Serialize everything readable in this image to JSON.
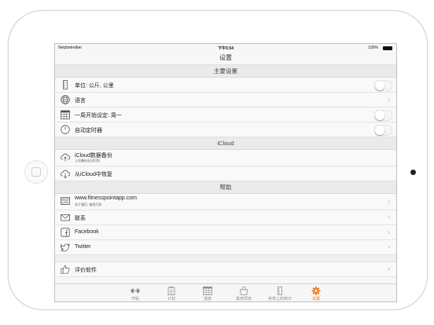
{
  "status_bar": {
    "carrier": "Netzbetreiber",
    "time": "下午5:54",
    "battery": "100%"
  },
  "nav": {
    "title": "设置"
  },
  "sections": [
    {
      "title": "主要设置"
    },
    {
      "title": "iCloud"
    },
    {
      "title": "帮助"
    }
  ],
  "main_rows": [
    {
      "label": "单位: 公斤, 公里",
      "icon": "ruler-icon",
      "control": "toggle",
      "on": false
    },
    {
      "label": "语言",
      "icon": "globe-icon",
      "control": "chevron"
    },
    {
      "label": "一周开始设定: 周一",
      "icon": "calendar-icon",
      "control": "toggle",
      "on": false
    },
    {
      "label": "自动定时器",
      "icon": "timer-icon",
      "control": "toggle",
      "on": false
    }
  ],
  "icloud_rows": [
    {
      "label": "iCloud数据备份",
      "sub": "上次备份无法识别",
      "icon": "cloud-upload-icon"
    },
    {
      "label": "从iCloud中恢复",
      "icon": "cloud-download-icon"
    }
  ],
  "help_rows": [
    {
      "label": "www.fitnesspointapp.com",
      "sub": "关于我们, 使用引导",
      "icon": "website-icon",
      "control": "chevron"
    },
    {
      "label": "联系",
      "icon": "mail-icon",
      "control": "chevron"
    },
    {
      "label": "Facebook",
      "icon": "facebook-icon",
      "control": "chevron"
    },
    {
      "label": "Twitter",
      "icon": "twitter-icon",
      "control": "chevron"
    }
  ],
  "rate_row": {
    "label": "评价软件",
    "icon": "thumbs-up-icon"
  },
  "chevron": "›",
  "tabs": [
    {
      "label": "开始",
      "icon": "dumbbell-icon",
      "active": false
    },
    {
      "label": "计划",
      "icon": "clipboard-icon",
      "active": false
    },
    {
      "label": "进度",
      "icon": "calendar-grid-icon",
      "active": false
    },
    {
      "label": "其他项目",
      "icon": "bag-icon",
      "active": false
    },
    {
      "label": "身体上的统计",
      "icon": "body-stats-icon",
      "active": false
    },
    {
      "label": "设置",
      "icon": "gear-icon",
      "active": true
    }
  ],
  "colors": {
    "accent": "#f07a1f",
    "icon_gray": "#555555",
    "tab_gray": "#8c8c8c"
  }
}
